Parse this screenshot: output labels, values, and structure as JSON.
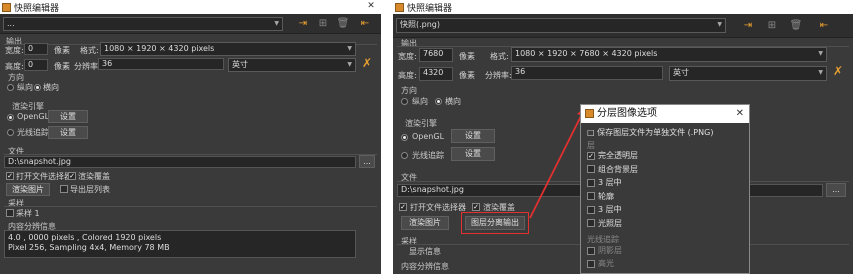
{
  "colors": {
    "accent": "#e0302f",
    "panel": "#3a3a3a",
    "input_bg": "#262626"
  },
  "left": {
    "title": "快照编辑器",
    "preset_value": "...",
    "sections": {
      "output": "输出",
      "direction": "方向",
      "renderer": "渲染引擎",
      "file": "文件",
      "capture": "采样",
      "info": "内容分辨信息"
    },
    "width_label": "宽度:",
    "width_value": "0",
    "ratio_label": "像素",
    "format_label": "格式:",
    "format_value": "1080 × 1920 × 4320 pixels",
    "height_label": "高度:",
    "height_value": "0",
    "ratio2_label": "像素",
    "resolution_label": "分辨率:",
    "resolution_value": "36",
    "units_value": "英寸",
    "orient_portrait": "纵向",
    "orient_landscape": "横向",
    "renderer_opengl": "OpenGL",
    "renderer_opengl_btn": "设置",
    "renderer_raytrace": "光线追踪",
    "renderer_raytrace_btn": "设置",
    "file_path": "D:\\snapshot.jpg",
    "file_browse": "...",
    "open_file_label": "打开文件选择器",
    "open_folder_label": "渲染覆盖",
    "render_btn": "渲染图片",
    "layers_btn": "导出层列表",
    "capture_label": "采样 1",
    "info_text": "4.0 , 0000 pixels , Colored 1920 pixels\nPixel 256, Sampling 4x4, Memory 78 MB"
  },
  "right": {
    "title": "快照编辑器",
    "preset_value": "快照(.png)",
    "sections": {
      "output": "输出",
      "direction": "方向",
      "renderer": "渲染引擎",
      "file": "文件",
      "capture": "采样",
      "info": "内容分辨信息"
    },
    "width_label": "宽度:",
    "width_value": "7680",
    "ratio_label": "像素",
    "format_label": "格式:",
    "format_value": "1080 × 1920 × 7680 × 4320 pixels",
    "height_label": "高度:",
    "height_value": "4320",
    "ratio2_label": "像素",
    "resolution_label": "分辨率:",
    "resolution_value": "36",
    "units_value": "英寸",
    "orient_portrait": "纵向",
    "orient_landscape": "横向",
    "renderer_opengl": "OpenGL",
    "renderer_opengl_btn": "设置",
    "renderer_raytrace": "光线追踪",
    "renderer_raytrace_btn": "设置",
    "file_path": "D:\\snapshot.jpg",
    "file_browse": "...",
    "open_file_label": "打开文件选择器",
    "open_folder_label": "渲染覆盖",
    "render_btn": "渲染图片",
    "layers_btn": "图层分离输出",
    "capture_label": "显示信息"
  },
  "popup": {
    "title": "分层图像选项",
    "subtitle": "□ 保存图层文件为单独文件 (.PNG)",
    "group_label": "层",
    "options": [
      {
        "label": "完全透明层",
        "checked": true
      },
      {
        "label": "组合背景层",
        "checked": false
      },
      {
        "label": "3 层中",
        "checked": false
      },
      {
        "label": "轮廓",
        "checked": false
      },
      {
        "label": "3 层中",
        "checked": false
      },
      {
        "label": "光照层",
        "checked": false
      }
    ],
    "ray_group": "光线追踪",
    "ray_options": [
      {
        "label": "阴影层",
        "checked": false
      },
      {
        "label": "高光",
        "checked": false
      }
    ]
  }
}
